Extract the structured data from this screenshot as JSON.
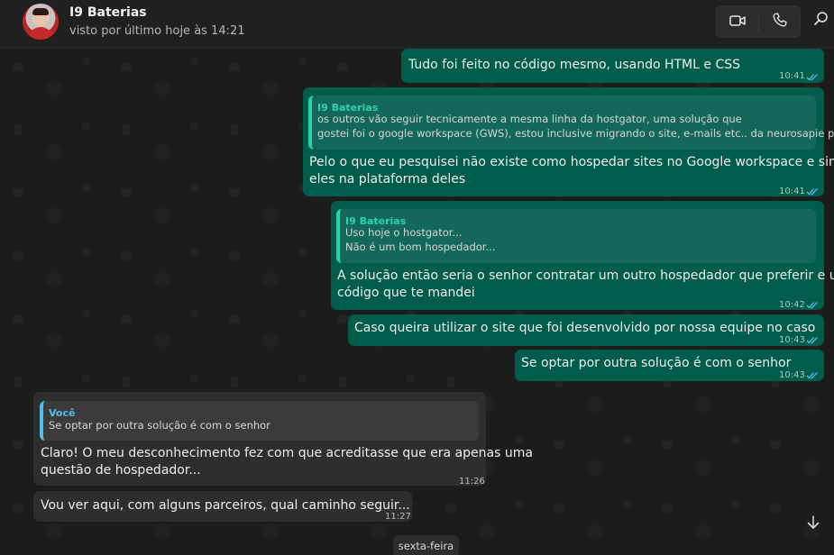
{
  "header": {
    "contact_name": "I9 Baterias",
    "last_seen": "visto por último hoje às 14:21"
  },
  "messages": [
    {
      "direction": "outgoing",
      "text": "Tudo foi feito no código mesmo, usando HTML e CSS",
      "time": "10:41"
    },
    {
      "direction": "outgoing",
      "quote_author": "I9 Baterias",
      "quote_lines": [
        "os outros vão seguir tecnicamente a mesma linha da hostgator, uma solução que",
        "gostei foi o google workspace (GWS), estou inclusive migrando o site, e-mails etc.. da neurosapie par..."
      ],
      "text_lines": [
        "Pelo o que eu pesquisei não existe como hospedar sites no Google workspace e sim fazer",
        "eles na plataforma deles"
      ],
      "time": "10:41"
    },
    {
      "direction": "outgoing",
      "quote_author": "I9 Baterias",
      "quote_lines": [
        "Uso hoje o hostgator...",
        "Não é um bom hospedador..."
      ],
      "text_lines": [
        "A solução então seria o senhor contratar um outro hospedador que preferir e upar o",
        "código que te mandei"
      ],
      "time": "10:42"
    },
    {
      "direction": "outgoing",
      "text": "Caso queira utilizar o site que foi desenvolvido por nossa equipe no caso",
      "time": "10:43"
    },
    {
      "direction": "outgoing",
      "text": "Se optar por outra solução é com o senhor",
      "time": "10:43"
    },
    {
      "direction": "incoming",
      "quote_author": "Você",
      "quote_lines": [
        "Se optar por outra solução é com o senhor"
      ],
      "text_lines": [
        "Claro! O meu desconhecimento fez com que acreditasse que era apenas uma",
        "questão de hospedador..."
      ],
      "time": "11:26"
    },
    {
      "direction": "incoming",
      "text": "Vou ver aqui, com alguns parceiros, qual caminho seguir...",
      "time": "11:27"
    }
  ],
  "date_separator": "sexta-feira",
  "icons": {
    "video": "video-call-icon",
    "phone": "voice-call-icon",
    "search": "search-icon",
    "scroll": "arrow-down-icon",
    "read_receipt": "double-check-icon"
  },
  "colors": {
    "outgoing_bubble": "#005c4b",
    "incoming_bubble": "#2e2e2e",
    "read_ticks": "#53bdeb",
    "quote_accent_outgoing": "#2bd4a8",
    "quote_accent_incoming": "#53bdeb"
  }
}
